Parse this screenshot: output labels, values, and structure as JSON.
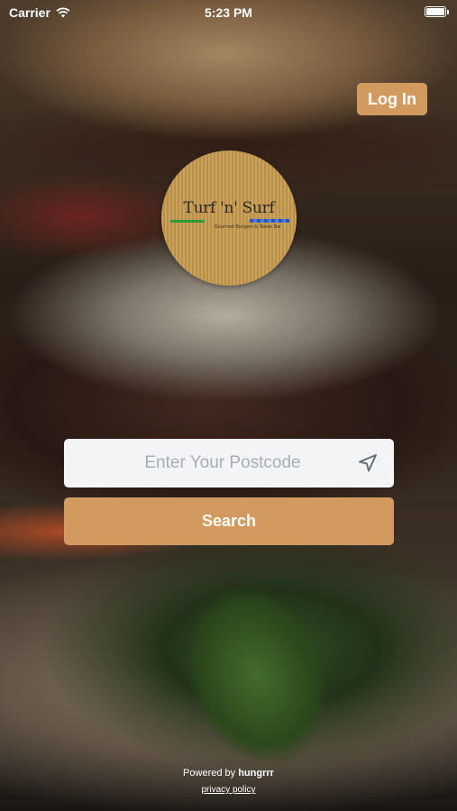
{
  "status_bar": {
    "carrier": "Carrier",
    "time": "5:23 PM"
  },
  "header": {
    "login_label": "Log In"
  },
  "logo": {
    "name": "Turf 'n' Surf",
    "tagline": "Gourmet Burgers & Steak Bar"
  },
  "search": {
    "placeholder": "Enter Your Postcode",
    "value": "",
    "button_label": "Search"
  },
  "footer": {
    "powered_by_prefix": "Powered by",
    "powered_by_brand": "hungrrr",
    "privacy_label": "privacy policy"
  },
  "colors": {
    "accent": "#d29a5e",
    "input_bg": "#f2f4f6",
    "placeholder": "#a9adb2"
  },
  "icons": {
    "wifi": "wifi-icon",
    "battery": "battery-icon",
    "location": "location-arrow-icon"
  }
}
